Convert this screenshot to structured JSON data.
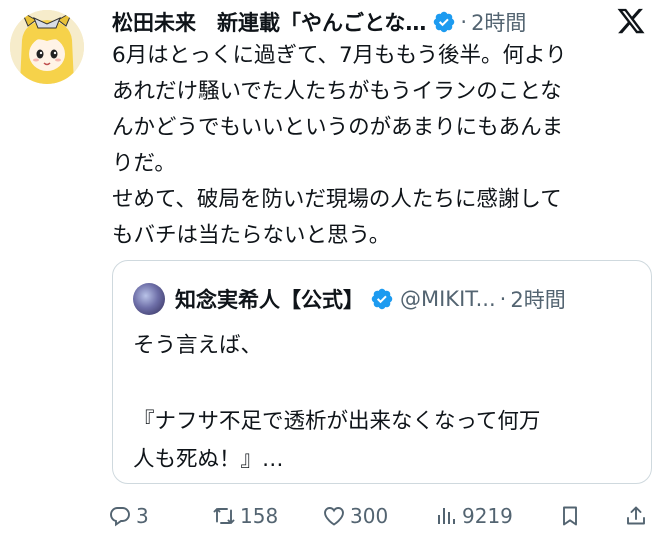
{
  "tweet": {
    "display_name": "松田未来　新連載「やんごとな…",
    "separator": "·",
    "time": "2時間",
    "body": [
      "6月はとっくに過ぎて、7月ももう後半。何より",
      "あれだけ騒いでた人たちがもうイランのことな",
      "んかどうでもいいというのがあまりにもあんま",
      "りだ。",
      "せめて、破局を防いだ現場の人たちに感謝して",
      "もバチは当たらないと思う。"
    ]
  },
  "quote": {
    "display_name": "知念実希人【公式】",
    "handle": "@MIKIT...",
    "separator": "·",
    "time": "2時間",
    "body": [
      "そう言えば、",
      "",
      "『ナフサ不足で透析が出来なくなって何万",
      "人も死ぬ！』…"
    ]
  },
  "actions": {
    "replies": "3",
    "reposts": "158",
    "likes": "300",
    "views": "9219"
  },
  "icons": {
    "brand": "x-logo-icon",
    "verified": "verified-badge-icon",
    "reply": "reply-icon",
    "repost": "repost-icon",
    "like": "like-icon",
    "views": "views-icon",
    "bookmark": "bookmark-icon",
    "share": "share-icon"
  },
  "colors": {
    "text": "#0f1419",
    "secondary": "#536471",
    "verified": "#1d9bf0",
    "border": "#cfd9de"
  }
}
